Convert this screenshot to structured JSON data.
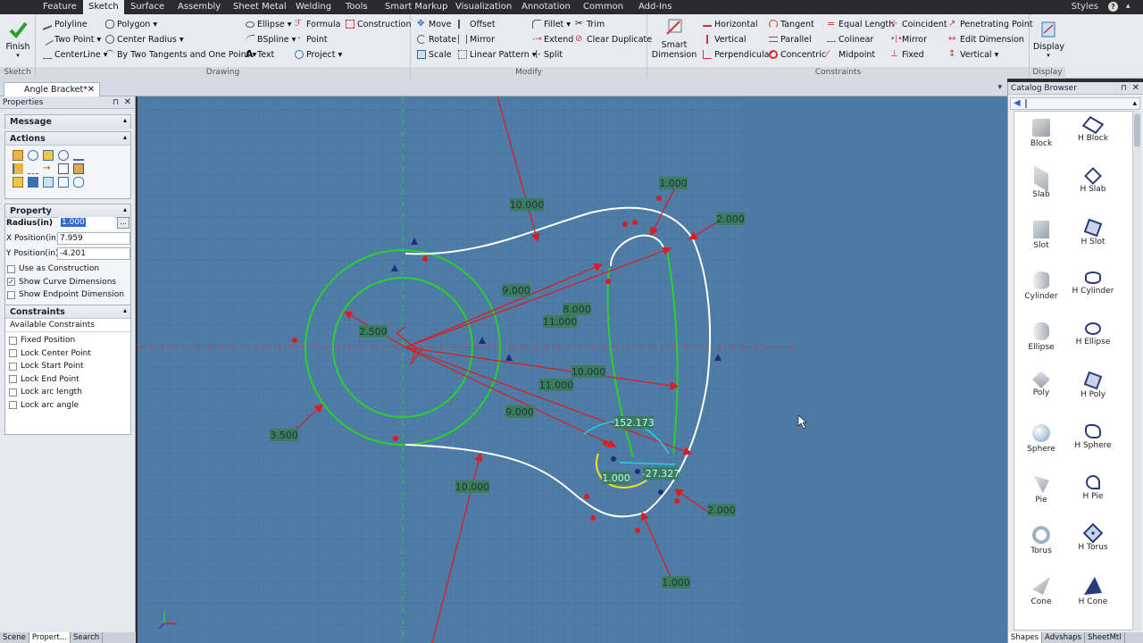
{
  "menu": {
    "tabs": [
      "Feature",
      "Sketch",
      "Surface",
      "Assembly",
      "Sheet Metal",
      "Welding",
      "Tools",
      "Smart Markup",
      "Visualization",
      "Annotation",
      "Common",
      "Add-Ins"
    ],
    "active": "Sketch",
    "styles_label": "Styles"
  },
  "ribbon": {
    "sketch_group": {
      "title": "Sketch",
      "finish": "Finish"
    },
    "drawing_group": {
      "title": "Drawing",
      "items": [
        "Polyline",
        "Two Point",
        "CenterLine",
        "Polygon",
        "Center Radius",
        "By Two Tangents and One Point",
        "Ellipse",
        "BSpline",
        "Text",
        "Formula",
        "Point",
        "Project",
        "Construction"
      ]
    },
    "modify_group": {
      "title": "Modify",
      "items": [
        "Move",
        "Rotate",
        "Scale",
        "Offset",
        "Mirror",
        "Linear Pattern",
        "Fillet",
        "Extend",
        "Split",
        "Trim",
        "Clear Duplicate"
      ]
    },
    "constraints_group": {
      "title": "Constraints",
      "smart_dimension": "Smart Dimension",
      "items": [
        "Horizontal",
        "Vertical",
        "Perpendicular",
        "Tangent",
        "Parallel",
        "Concentric",
        "Equal Length",
        "Colinear",
        "Midpoint",
        "Coincident",
        "Mirror",
        "Fixed",
        "Penetrating Point",
        "Edit Dimension",
        "Vertical"
      ]
    },
    "display_group": {
      "title": "Display",
      "display": "Display"
    }
  },
  "document": {
    "tab_title": "Angle Bracket*"
  },
  "properties": {
    "panel_title": "Properties",
    "message_title": "Message",
    "actions_title": "Actions",
    "property_title": "Property",
    "radius_label": "Radius(in)",
    "radius_value": "1.000",
    "x_label": "X Position(in)",
    "x_value": "7.959",
    "y_label": "Y Position(in)",
    "y_value": "-4.201",
    "options": [
      {
        "label": "Use as Construction",
        "checked": false
      },
      {
        "label": "Show Curve Dimensions",
        "checked": true
      },
      {
        "label": "Show Endpoint Dimension",
        "checked": false
      }
    ],
    "constraints_title": "Constraints",
    "available_title": "Available Constraints",
    "constraints": [
      "Fixed Position",
      "Lock Center Point",
      "Lock Start Point",
      "Lock End Point",
      "Lock arc length",
      "Lock arc angle"
    ],
    "bottom_tabs": [
      "Scene",
      "Propert...",
      "Search"
    ]
  },
  "sketch": {
    "dimensions": [
      "10.000",
      "1.000",
      "2.000",
      "9.000",
      "8.000",
      "11.000",
      "2.500",
      "10.000",
      "11.000",
      "9.000",
      "3.500",
      "10.000",
      "152.173",
      "-27.327",
      "1.000",
      "2.000",
      "1.000"
    ]
  },
  "catalog": {
    "title": "Catalog Browser",
    "items": [
      [
        "Block",
        "H Block"
      ],
      [
        "Slab",
        "H Slab"
      ],
      [
        "Slot",
        "H Slot"
      ],
      [
        "Cylinder",
        "H Cylinder"
      ],
      [
        "Ellipse",
        "H Ellipse"
      ],
      [
        "Poly",
        "H Poly"
      ],
      [
        "Sphere",
        "H Sphere"
      ],
      [
        "Pie",
        "H Pie"
      ],
      [
        "Torus",
        "H Torus"
      ],
      [
        "Cone",
        "H Cone"
      ]
    ],
    "tabs": [
      "Shapes",
      "Advshaps",
      "SheetMtl"
    ]
  },
  "colors": {
    "canvas": "#4d7aa4",
    "green": "#27d22a",
    "red": "#e01a1a",
    "white": "#ffffff",
    "accent": "#2f6cc9"
  }
}
